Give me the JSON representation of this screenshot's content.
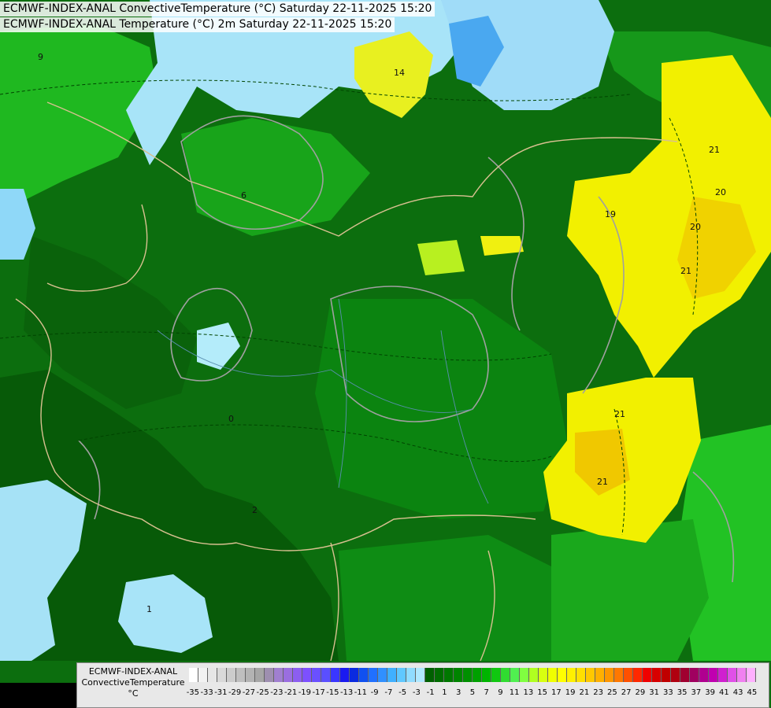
{
  "header": {
    "line1": "ECMWF-INDEX-ANAL ConvectiveTemperature (°C) Saturday 22-11-2025 15:20",
    "line2": "ECMWF-INDEX-ANAL Temperature (°C) 2m Saturday 22-11-2025 15:20"
  },
  "legend": {
    "title_line1": "ECMWF-INDEX-ANAL",
    "title_line2": "ConvectiveTemperature",
    "title_line3": "°C",
    "ticks": [
      "-35",
      "-33",
      "-31",
      "-29",
      "-27",
      "-25",
      "-23",
      "-21",
      "-19",
      "-17",
      "-15",
      "-13",
      "-11",
      "-9",
      "-7",
      "-5",
      "-3",
      "-1",
      "1",
      "3",
      "5",
      "7",
      "9",
      "11",
      "13",
      "15",
      "17",
      "19",
      "21",
      "23",
      "25",
      "27",
      "29",
      "31",
      "33",
      "35",
      "37",
      "39",
      "41",
      "43",
      "45"
    ],
    "colors": [
      "#ffffff",
      "#f2f2f2",
      "#e6e6e6",
      "#d9d9d9",
      "#cccccc",
      "#bfbfbf",
      "#b3b3b3",
      "#a6a6a6",
      "#9e8fb0",
      "#a07fd0",
      "#9a6ee0",
      "#8c5ef0",
      "#7d50ff",
      "#6a50ff",
      "#5a4fff",
      "#3a36ff",
      "#1a1af0",
      "#0a2ae0",
      "#1050f0",
      "#2070ff",
      "#3090ff",
      "#40b0ff",
      "#60c8ff",
      "#90dcff",
      "#b0e8ff",
      "#006000",
      "#006c00",
      "#007800",
      "#008400",
      "#009000",
      "#00a000",
      "#00b400",
      "#10c810",
      "#30dc30",
      "#50f050",
      "#80ff40",
      "#b0ff20",
      "#d8ff10",
      "#f0ff00",
      "#ffff00",
      "#fff000",
      "#ffe000",
      "#ffc800",
      "#ffb000",
      "#ff9600",
      "#ff7800",
      "#ff5000",
      "#ff2800",
      "#f00000",
      "#d80000",
      "#c00000",
      "#b00010",
      "#a00030",
      "#a00060",
      "#b00090",
      "#c000b0",
      "#d020d0",
      "#e050e8",
      "#f080f0",
      "#ffb0ff"
    ]
  },
  "map": {
    "contour_labels": [
      "14",
      "21",
      "20",
      "20",
      "21",
      "21",
      "21",
      "19",
      "6",
      "0",
      "2",
      "1",
      "9"
    ]
  },
  "colors": {
    "dark_green": "#0a5c0a",
    "mid_green": "#0f7a12",
    "bright_green": "#2ecc2e",
    "yellow": "#f2f000",
    "orange_yellow": "#f0c800",
    "light_blue": "#a8e4f8",
    "sky_blue": "#5ec2f2"
  }
}
